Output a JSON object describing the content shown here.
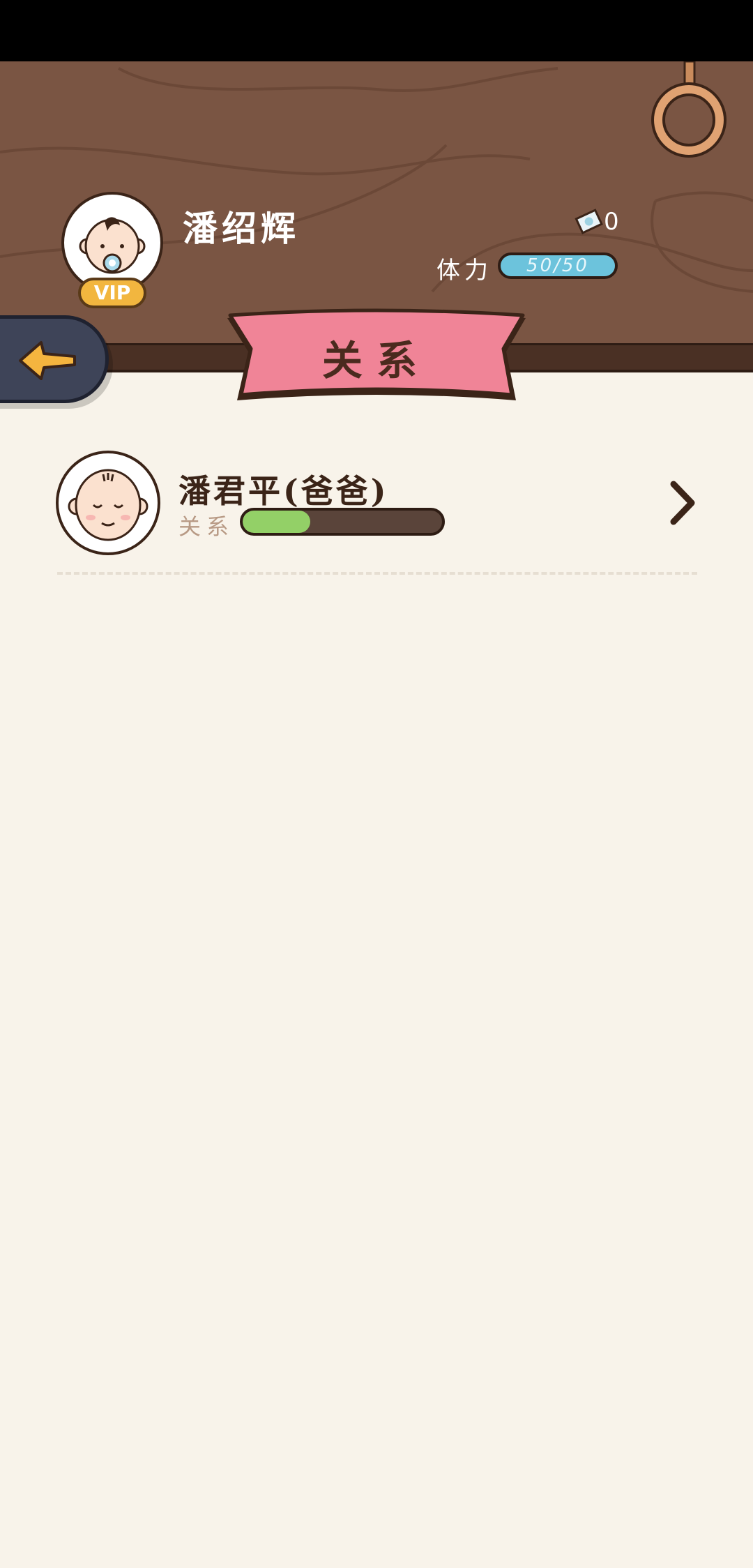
{
  "player": {
    "name": "潘绍辉",
    "vip_label": "VIP",
    "coins": "0",
    "stamina_label": "体力",
    "stamina_text": "50/50",
    "stamina_fraction": 1.0
  },
  "page": {
    "title": "关系"
  },
  "relations": [
    {
      "name": "潘君平(爸爸)",
      "label": "关系",
      "progress_fraction": 0.34
    }
  ],
  "colors": {
    "header_wood": "#7a5543",
    "banner_pink": "#f08497",
    "background": "#f8f3ea",
    "stamina_blue": "#6cc3dc",
    "relation_green": "#93d067"
  },
  "icons": {
    "back": "arrow-left-icon",
    "coin": "money-bill-icon",
    "ring": "hanging-ring-icon",
    "chevron": "chevron-right-icon"
  }
}
